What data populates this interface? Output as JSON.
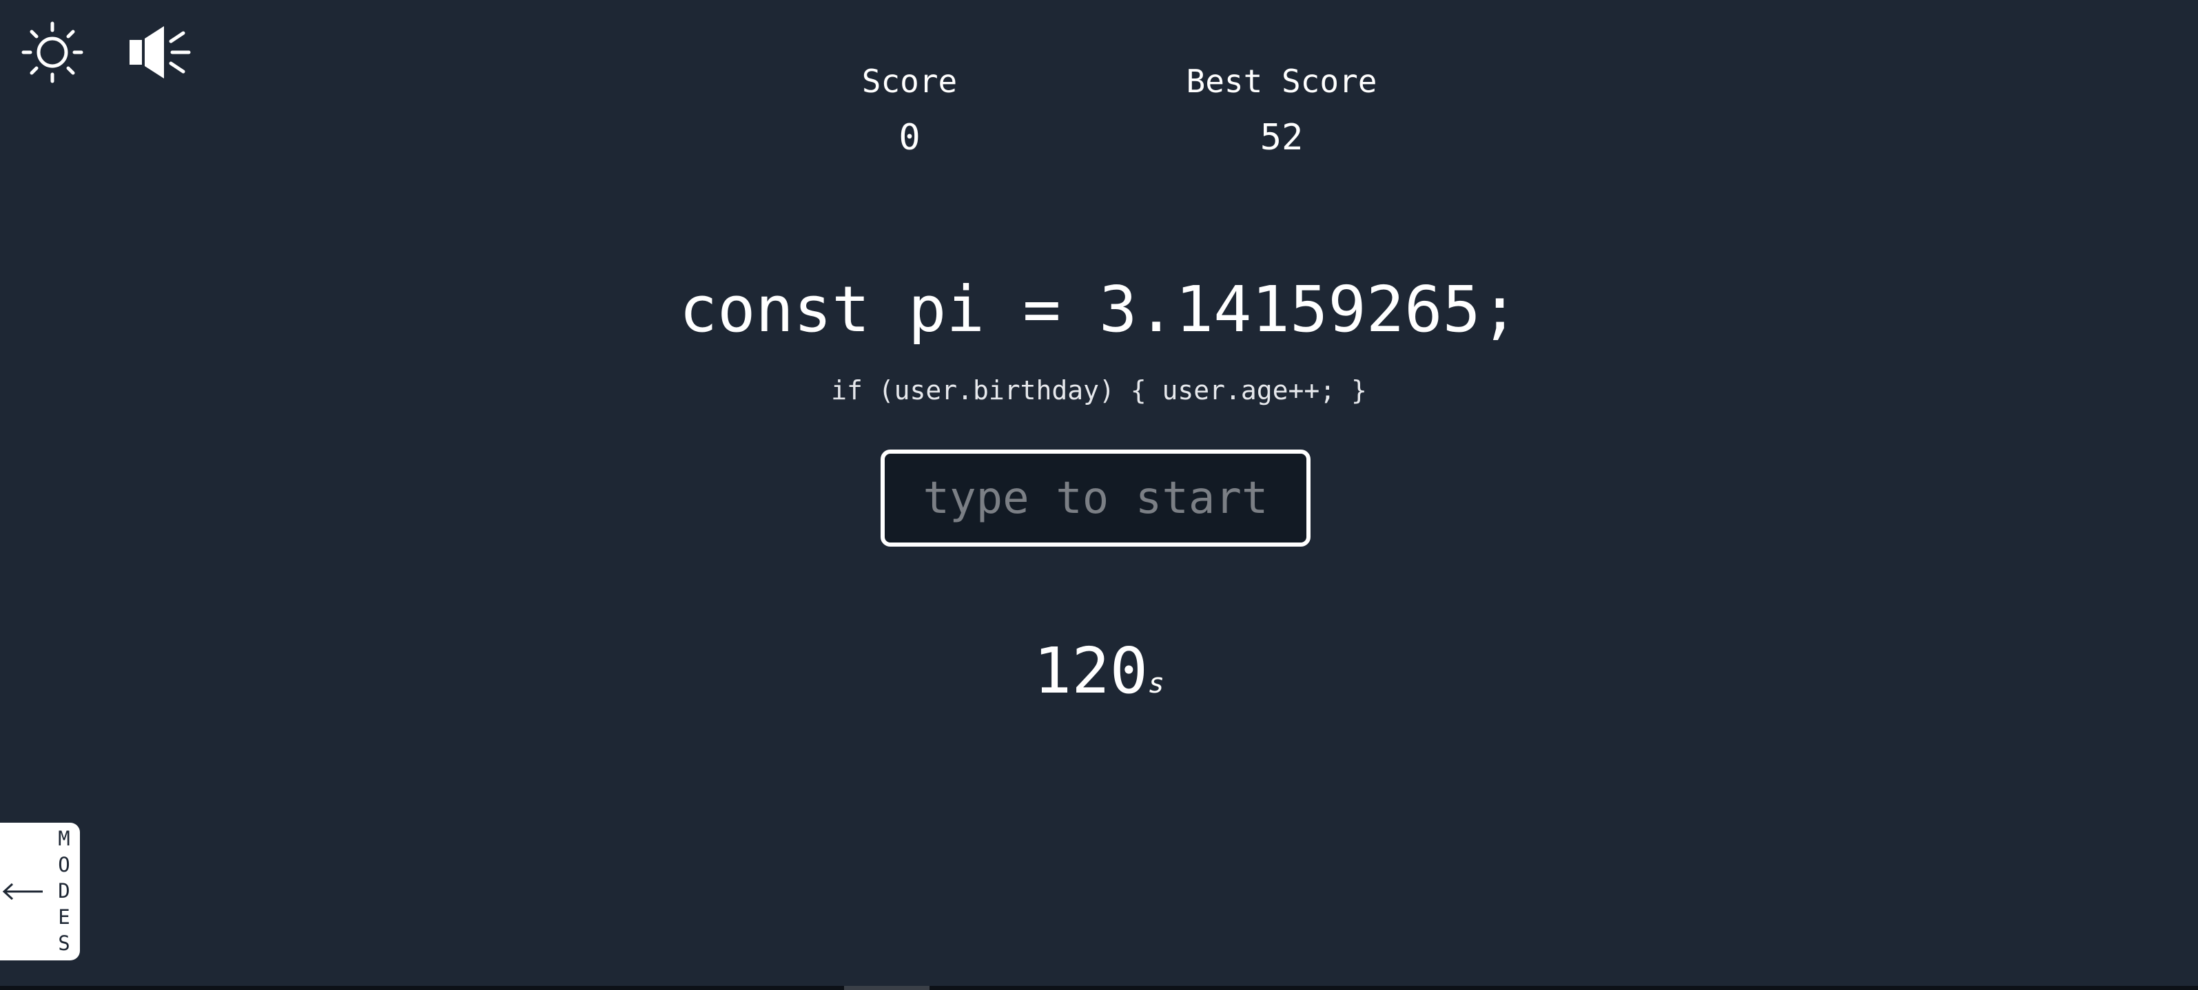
{
  "toolbar": {
    "theme_icon": "sun-icon",
    "sound_icon": "speaker-icon"
  },
  "scores": {
    "score_label": "Score",
    "score_value": "0",
    "best_label": "Best Score",
    "best_value": "52"
  },
  "words": {
    "current": "const pi = 3.14159265;",
    "next": "if (user.birthday) { user.age++; }"
  },
  "input": {
    "placeholder": "type to start",
    "value": ""
  },
  "timer": {
    "value": "120",
    "unit": "s"
  },
  "modes": {
    "letters": [
      "M",
      "O",
      "D",
      "E",
      "S"
    ],
    "arrow_icon": "arrow-left-icon"
  },
  "colors": {
    "background": "#1e2734",
    "text": "#ffffff",
    "placeholder": "#7b7f85"
  }
}
